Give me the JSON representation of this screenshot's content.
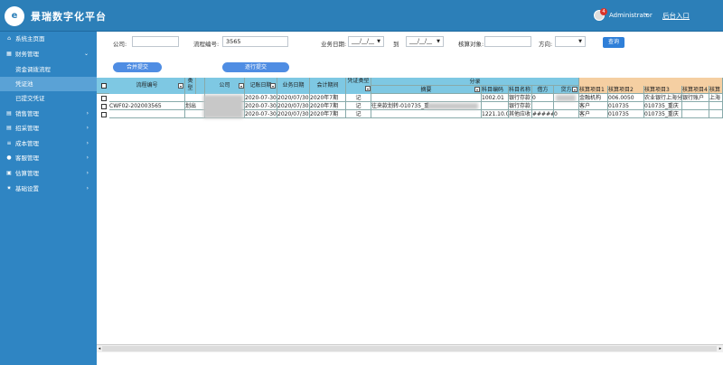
{
  "app": {
    "title": "景瑞数字化平台",
    "logo": "e"
  },
  "header": {
    "badge": "4",
    "user": "Administrator",
    "caret": "▾",
    "back": "后台入口"
  },
  "sidebar": {
    "items": [
      {
        "label": "系统主页面",
        "icon": "home-icon",
        "glyph": "⌂",
        "chevron": ""
      },
      {
        "label": "财务管理",
        "icon": "money-icon",
        "glyph": "▦",
        "chevron": "⌄"
      },
      {
        "label": "资金调拨流程",
        "icon": "",
        "glyph": "",
        "chevron": ""
      },
      {
        "label": "凭证池",
        "icon": "",
        "glyph": "",
        "chevron": ""
      },
      {
        "label": "已提交凭证",
        "icon": "",
        "glyph": "",
        "chevron": ""
      },
      {
        "label": "销售管理",
        "icon": "sales-icon",
        "glyph": "▤",
        "chevron": "›"
      },
      {
        "label": "招采管理",
        "icon": "purchase-icon",
        "glyph": "▤",
        "chevron": "›"
      },
      {
        "label": "成本管理",
        "icon": "cost-icon",
        "glyph": "≡",
        "chevron": "›"
      },
      {
        "label": "客服管理",
        "icon": "service-icon",
        "glyph": "●",
        "chevron": "›"
      },
      {
        "label": "估算管理",
        "icon": "estimate-icon",
        "glyph": "▣",
        "chevron": "›"
      },
      {
        "label": "基础设置",
        "icon": "settings-icon",
        "glyph": "✷",
        "chevron": "›"
      }
    ]
  },
  "filters": {
    "company_label": "公司:",
    "company_value": "",
    "flow_label": "流程编号:",
    "flow_value": "3565",
    "bizdate_label": "业务日期:",
    "date_from": "___/__/__",
    "date_to_label": "到",
    "date_to": "___/__/__",
    "account_obj_label": "核算对象:",
    "account_obj_value": "",
    "direction_label": "方向:",
    "direction_value": "",
    "query_button": "查询"
  },
  "actions": {
    "merge_submit": "合并提交",
    "batch_submit": "逐行提交"
  },
  "grid": {
    "headers": {
      "flow_no": "流程编号",
      "type": "类型",
      "company": "公司",
      "record_date": "记账日期",
      "biz_date": "业务日期",
      "period": "会计期间",
      "voucher_type": "凭证类型",
      "entry_group": "分录",
      "summary": "摘要",
      "subject_code": "科目编码",
      "subject_name": "科目名称",
      "debit": "借方",
      "credit": "贷方",
      "acct1": "核算项目1",
      "acct2": "核算项目2",
      "acct3": "核算项目3",
      "acct4": "核算项目4",
      "acct5": "核算项目5",
      "acct6": "核算"
    },
    "rows": [
      {
        "flow_no": "",
        "type": "",
        "company": "",
        "record_date": "2020-07-30",
        "biz_date": "2020/07/30",
        "period": "2020年7期",
        "voucher_type": "记",
        "summary": "",
        "subject_code": "1002.01",
        "subject_name": "银行存款",
        "debit": "0",
        "credit": "",
        "acct1": "金融机构",
        "acct2": "006.0050",
        "acct3": "农业银行上海分",
        "acct4": "银行账户",
        "acct5": "上海",
        "acct6": ""
      },
      {
        "flow_no": "CWF02-202003565",
        "type": "划出",
        "company": "",
        "record_date": "2020-07-30",
        "biz_date": "2020/07/30",
        "period": "2020年7期",
        "voucher_type": "记",
        "summary": "往来款划转-010735_重",
        "subject_code": "",
        "subject_name": "银行存款",
        "debit": "",
        "credit": "",
        "acct1": "客户",
        "acct2": "010735",
        "acct3": "010735_重庆",
        "acct4": "",
        "acct5": "",
        "acct6": ""
      },
      {
        "flow_no": "",
        "type": "",
        "company": "",
        "record_date": "2020-07-30",
        "biz_date": "2020/07/30",
        "period": "2020年7期",
        "voucher_type": "记",
        "summary": "",
        "subject_code": "1221.10.0",
        "subject_name": "其他应收",
        "debit": "#####",
        "credit": "0",
        "acct1": "客户",
        "acct2": "010735",
        "acct3": "010735_重庆",
        "acct4": "",
        "acct5": "",
        "acct6": ""
      }
    ]
  },
  "colors": {
    "header": "#2c7fb8",
    "sidebar": "#2f85c3",
    "sidebar_active": "#5aa2d6",
    "grid_header": "#7ec8e3",
    "grid_header_orange": "#f5cfa2",
    "button": "#4f8de3"
  }
}
